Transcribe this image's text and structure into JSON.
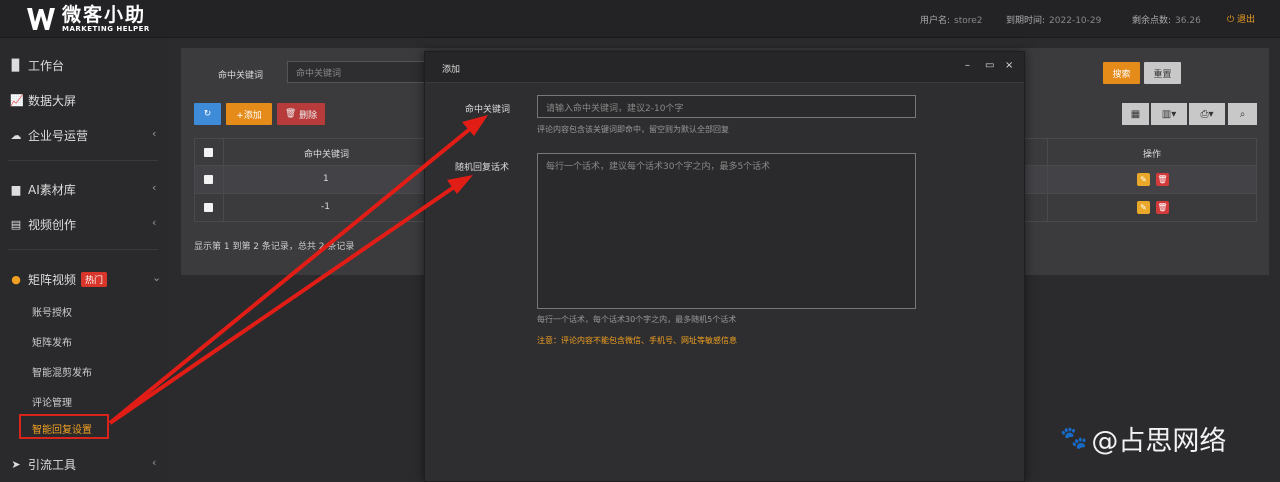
{
  "app": {
    "logo_cn": "微客小助",
    "logo_en": "MARKETING HELPER",
    "user_label": "用户名:",
    "user_value": "store2",
    "expire_label": "到期时间:",
    "expire_value": "2022-10-29",
    "points_label": "剩余点数:",
    "points_value": "36.26",
    "logout": "退出"
  },
  "sidebar": {
    "items": [
      {
        "label": "工作台",
        "icon": "monitor-icon"
      },
      {
        "label": "数据大屏",
        "icon": "chart-icon"
      },
      {
        "label": "企业号运营",
        "icon": "cloud-icon"
      },
      {
        "label": "AI素材库",
        "icon": "folder-icon"
      },
      {
        "label": "视频创作",
        "icon": "film-icon"
      },
      {
        "label": "矩阵视频",
        "icon": "video-icon",
        "badge": "热门"
      },
      {
        "label": "引流工具",
        "icon": "send-icon"
      }
    ],
    "sub_items": [
      "账号授权",
      "矩阵发布",
      "智能混剪发布",
      "评论管理",
      "智能回复设置"
    ]
  },
  "main": {
    "filter_label": "命中关键词",
    "filter_placeholder": "命中关键词",
    "search_label": "搜索",
    "reset_label": "重置",
    "refresh_icon": "refresh-icon",
    "add_label": "+添加",
    "delete_label": "删除",
    "table": {
      "headers": [
        "命中关键词",
        "操作"
      ],
      "rows": [
        {
          "keyword": "1"
        },
        {
          "keyword": "-1"
        }
      ]
    },
    "pager": "显示第 1 到第 2 条记录，总共 2 条记录"
  },
  "modal": {
    "title": "添加",
    "keyword_label": "命中关键词",
    "keyword_placeholder": "请输入命中关键词，建议2-10个字",
    "keyword_hint": "评论内容包含该关键词即命中，留空则为默认全部回复",
    "reply_label": "随机回复话术",
    "reply_placeholder": "每行一个话术，建议每个话术30个字之内，最多5个话术",
    "reply_hint": "每行一个话术，每个话术30个字之内，最多随机5个话术",
    "note": "注意：评论内容不能包含微信、手机号、网址等敏感信息"
  },
  "watermark": "@占思网络",
  "colors": {
    "accent": "#f0a020",
    "danger": "#d33b3b",
    "primary": "#3d8bd9",
    "arrow": "#e21d16"
  }
}
